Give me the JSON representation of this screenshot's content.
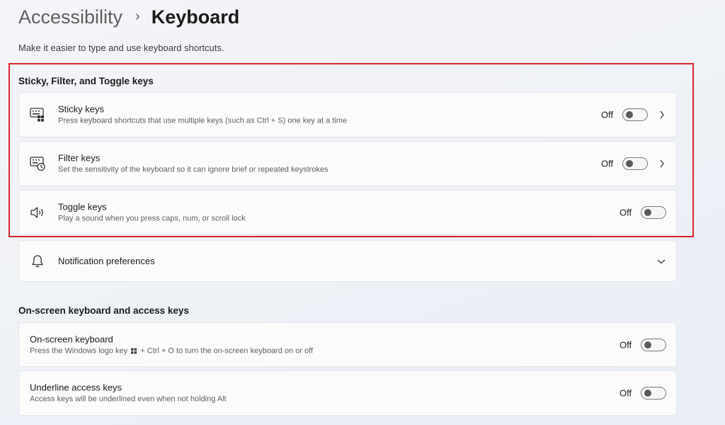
{
  "breadcrumb": {
    "parent": "Accessibility",
    "separator": "›",
    "current": "Keyboard"
  },
  "page_description": "Make it easier to type and use keyboard shortcuts.",
  "sections": {
    "sticky_filter_toggle": {
      "title": "Sticky, Filter, and Toggle keys",
      "items": [
        {
          "title": "Sticky keys",
          "subtitle": "Press keyboard shortcuts that use multiple keys (such as Ctrl + S) one key at a time",
          "state": "Off",
          "icon": "sticky-keys-icon"
        },
        {
          "title": "Filter keys",
          "subtitle": "Set the sensitivity of the keyboard so it can ignore brief or repeated keystrokes",
          "state": "Off",
          "icon": "filter-keys-icon"
        },
        {
          "title": "Toggle keys",
          "subtitle": "Play a sound when you press caps, num, or scroll lock",
          "state": "Off",
          "icon": "speaker-icon"
        }
      ]
    },
    "notification": {
      "title": "Notification preferences",
      "icon": "bell-icon"
    },
    "onscreen": {
      "title": "On-screen keyboard and access keys",
      "items": [
        {
          "title": "On-screen keyboard",
          "subtitle_before": "Press the Windows logo key",
          "subtitle_after": "+ Ctrl + O to turn the on-screen keyboard on or off",
          "state": "Off"
        },
        {
          "title": "Underline access keys",
          "subtitle": "Access keys will be underlined even when not holding Alt",
          "state": "Off"
        }
      ]
    }
  },
  "colors": {
    "highlight": "#d7262c",
    "toggle_off_knob": "#5a5a5a"
  }
}
